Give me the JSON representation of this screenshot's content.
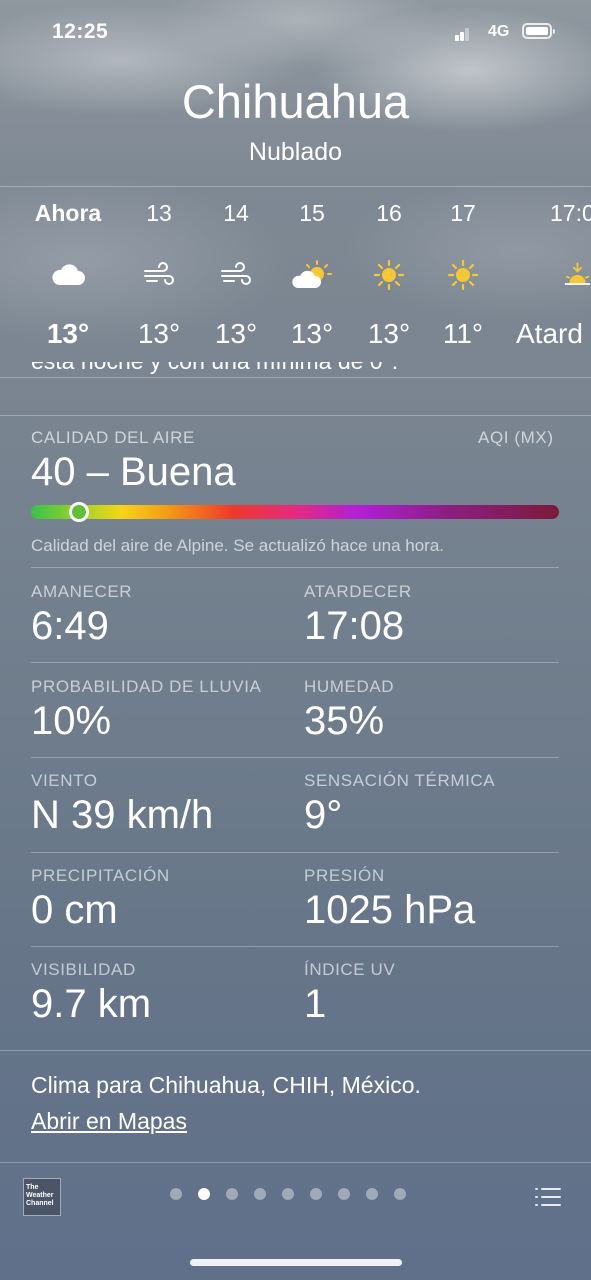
{
  "status_bar": {
    "time": "12:25",
    "network": "4G"
  },
  "header": {
    "city": "Chihuahua",
    "condition": "Nublado"
  },
  "hourly": [
    {
      "label": "Ahora",
      "icon": "cloud-icon",
      "temp": "13°"
    },
    {
      "label": "13",
      "icon": "wind-icon",
      "temp": "13°"
    },
    {
      "label": "14",
      "icon": "wind-icon",
      "temp": "13°"
    },
    {
      "label": "15",
      "icon": "partly-sunny-icon",
      "temp": "13°"
    },
    {
      "label": "16",
      "icon": "sun-icon",
      "temp": "13°"
    },
    {
      "label": "17",
      "icon": "sun-icon",
      "temp": "11°"
    },
    {
      "label": "17:0",
      "icon": "sunset-icon",
      "temp": "Atard"
    }
  ],
  "forecast_text_clipped": "esta noche y con una mínima de 0°.",
  "air_quality": {
    "label": "CALIDAD DEL AIRE",
    "scale": "AQI (MX)",
    "value": "40 – Buena",
    "level_fraction": 0.09,
    "note": "Calidad del aire de Alpine. Se actualizó hace una hora."
  },
  "details": [
    {
      "left": {
        "label": "AMANECER",
        "value": "6:49"
      },
      "right": {
        "label": "ATARDECER",
        "value": "17:08"
      }
    },
    {
      "left": {
        "label": "PROBABILIDAD DE LLUVIA",
        "value": "10%"
      },
      "right": {
        "label": "HUMEDAD",
        "value": "35%"
      }
    },
    {
      "left": {
        "label": "VIENTO",
        "value": "N 39 km/h"
      },
      "right": {
        "label": "SENSACIÓN TÉRMICA",
        "value": "9°"
      }
    },
    {
      "left": {
        "label": "PRECIPITACIÓN",
        "value": "0 cm"
      },
      "right": {
        "label": "PRESIÓN",
        "value": "1025 hPa"
      }
    },
    {
      "left": {
        "label": "VISIBILIDAD",
        "value": "9.7 km"
      },
      "right": {
        "label": "ÍNDICE UV",
        "value": "1"
      }
    }
  ],
  "footer": {
    "text": "Clima para Chihuahua, CHIH, México.",
    "link": "Abrir en Mapas"
  },
  "bottom_bar": {
    "logo_text": "The Weather Channel",
    "page_count": 9,
    "active_page": 1
  }
}
